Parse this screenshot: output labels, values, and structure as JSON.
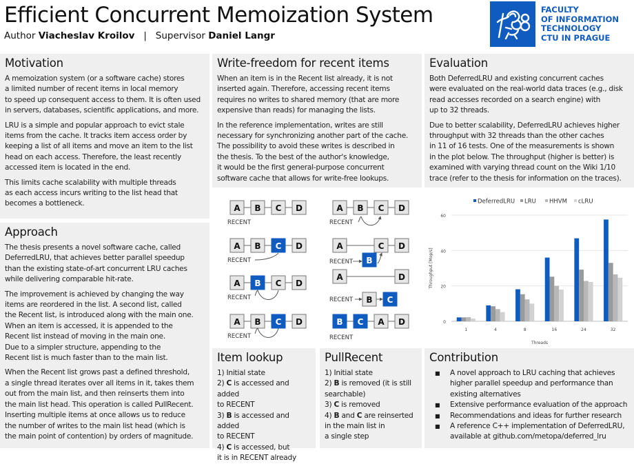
{
  "header": {
    "title": "Efficient Concurrent Memoization System",
    "author_label": "Author",
    "author": "Viacheslav Kroilov",
    "separator": "|",
    "supervisor_label": "Supervisor",
    "supervisor": "Daniel Langr"
  },
  "logo": {
    "lines": [
      "FACULTY",
      "OF INFORMATION",
      "TECHNOLOGY",
      "CTU IN PRAGUE"
    ],
    "color": "#0f5bbf"
  },
  "motivation": {
    "title": "Motivation",
    "paragraphs": [
      [
        "A memoization system (or a software cache) stores",
        "a limited number of recent items in local memory",
        "to speed up consequent access to them. It is often used",
        "in servers, databases, scientific applications, and more."
      ],
      [
        "LRU is a simple and popular approach to evict stale",
        "items from the cache. It tracks item access order by",
        "keeping a list of all items and move an item to the list",
        "head on each access. Therefore, the least recently",
        "accessed item is located in the end."
      ],
      [
        "This limits cache scalability with multiple threads",
        "as each access incurs writing to the list head that",
        "becomes a bottleneck."
      ]
    ]
  },
  "approach": {
    "title": "Approach",
    "paragraphs": [
      [
        "The thesis presents a novel software cache, called",
        "DeferredLRU, that achieves better parallel speedup",
        "than the existing state-of-art concurrent LRU caches",
        "while delivering comparable hit-rate."
      ],
      [
        "The improvement is achieved by changing the way",
        "items are reordered in the list. A second list, called",
        "the Recent list, is introduced along with the main one.",
        "When an item is accessed, it is appended to the",
        "Recent list instead of moving in the main one.",
        "Due to a simpler structure, appending to the",
        "Recent list is much faster than to the main list."
      ],
      [
        "When the Recent list grows past a defined threshold,",
        "a single thread iterates over all items in it, takes them",
        "out from the main list, and then reinserts them into",
        "the main list head. This operation is called PullRecent.",
        "Inserting multiple items at once allows us to reduce",
        "the number of writes to the main list head (which is",
        "the main point of contention) by orders of magnitude."
      ]
    ]
  },
  "write_freedom": {
    "title": "Write-freedom for recent items",
    "paragraphs": [
      [
        "When an item is in the Recent list already, it is not",
        "inserted again. Therefore, accessing recent items",
        "requires no writes to shared memory (that are more",
        "expensive than reads) for managing the lists."
      ],
      [
        "In the reference implementation, writes are still",
        "necessary for synchronizing another part of the cache.",
        "The possibility to avoid these writes is described in",
        "the thesis. To the best of the author's knowledge,",
        "it would be the first general-purpose concurrent",
        "software cache that allows for write-free lookups."
      ]
    ]
  },
  "diagram": {
    "recent_label": "RECENT",
    "node_labels": [
      "A",
      "B",
      "C",
      "D"
    ],
    "highlight_color": "#0f5bbf",
    "node_fill": "#e6e6e6",
    "node_stroke": "#777777"
  },
  "item_lookup": {
    "title": "Item lookup",
    "steps": [
      {
        "prefix": "1) ",
        "bold": "",
        "rest": "Initial state"
      },
      {
        "prefix": "2) ",
        "bold": "C",
        "rest": " is accessed and added"
      },
      {
        "prefix": "",
        "bold": "",
        "rest": "to RECENT"
      },
      {
        "prefix": "3) ",
        "bold": "B",
        "rest": " is accessed and added"
      },
      {
        "prefix": "",
        "bold": "",
        "rest": "to RECENT"
      },
      {
        "prefix": "4) ",
        "bold": "C",
        "rest": " is accessed, but"
      },
      {
        "prefix": "",
        "bold": "",
        "rest": "it is in RECENT already"
      }
    ]
  },
  "pull_recent": {
    "title": "PullRecent",
    "steps": [
      {
        "prefix": "1) ",
        "bold": "",
        "rest": "Initial state"
      },
      {
        "prefix": "2) ",
        "bold": "B",
        "rest": " is removed (it is still"
      },
      {
        "prefix": "",
        "bold": "",
        "rest": "searchable)"
      },
      {
        "prefix": "3) ",
        "bold": "C",
        "rest": " is removed"
      },
      {
        "prefix": "4) ",
        "bold": "B",
        "rest": " and ",
        "bold2": "C",
        "rest2": " are reinserted"
      },
      {
        "prefix": "",
        "bold": "",
        "rest": "in the main list in"
      },
      {
        "prefix": "",
        "bold": "",
        "rest": "a single step"
      }
    ]
  },
  "evaluation": {
    "title": "Evaluation",
    "paragraphs": [
      [
        "Both DeferredLRU and existing concurrent caches",
        "were evaluated on the real-world data traces (e.g., disk",
        "read accesses recorded on a search engine) with",
        "up to 32 threads."
      ],
      [
        "Due to better scalability, DeferredLRU achieves higher",
        "throughput with 32 threads than the other caches",
        "in 11 of 16 tests. One of the measurements is shown",
        "in the plot below. The throughput (higher is better) is",
        "examined with varying thread count on the Wiki 1/10",
        "trace (refer to the thesis for information on the traces)."
      ]
    ]
  },
  "contribution": {
    "title": "Contribution",
    "bullet": "■",
    "items": [
      [
        "A novel approach to LRU caching that achieves",
        "higher parallel speedup and performance than",
        "existing alternatives"
      ],
      [
        "Extensive performance evaluation of the approach"
      ],
      [
        "Recommendations and ideas for further research"
      ],
      [
        "A reference C++ implementation of DeferredLRU,",
        "available at github.com/metopa/deferred_lru"
      ]
    ]
  },
  "chart_data": {
    "type": "bar",
    "title": "",
    "xlabel": "Threads",
    "ylabel": "Throughput [Mop/s]",
    "categories": [
      "1",
      "4",
      "8",
      "16",
      "24",
      "32"
    ],
    "ylim": [
      0,
      60
    ],
    "yticks": [
      0,
      20,
      40,
      60
    ],
    "grid": true,
    "legend": "top",
    "series": [
      {
        "name": "DeferredLRU",
        "color": "#0f5bbf",
        "values": [
          2.2,
          9.0,
          18.1,
          36.0,
          46.9,
          57.5
        ]
      },
      {
        "name": "LRU",
        "color": "#9a9a9a",
        "values": [
          2.2,
          8.5,
          15.3,
          25.2,
          29.2,
          33.0
        ]
      },
      {
        "name": "HHVM",
        "color": "#b8b8b8",
        "values": [
          2.3,
          6.9,
          12.4,
          20.0,
          22.8,
          26.5
        ]
      },
      {
        "name": "cLRU",
        "color": "#d2d2d2",
        "values": [
          1.5,
          5.2,
          10.0,
          17.9,
          22.2,
          24.6
        ]
      }
    ]
  }
}
